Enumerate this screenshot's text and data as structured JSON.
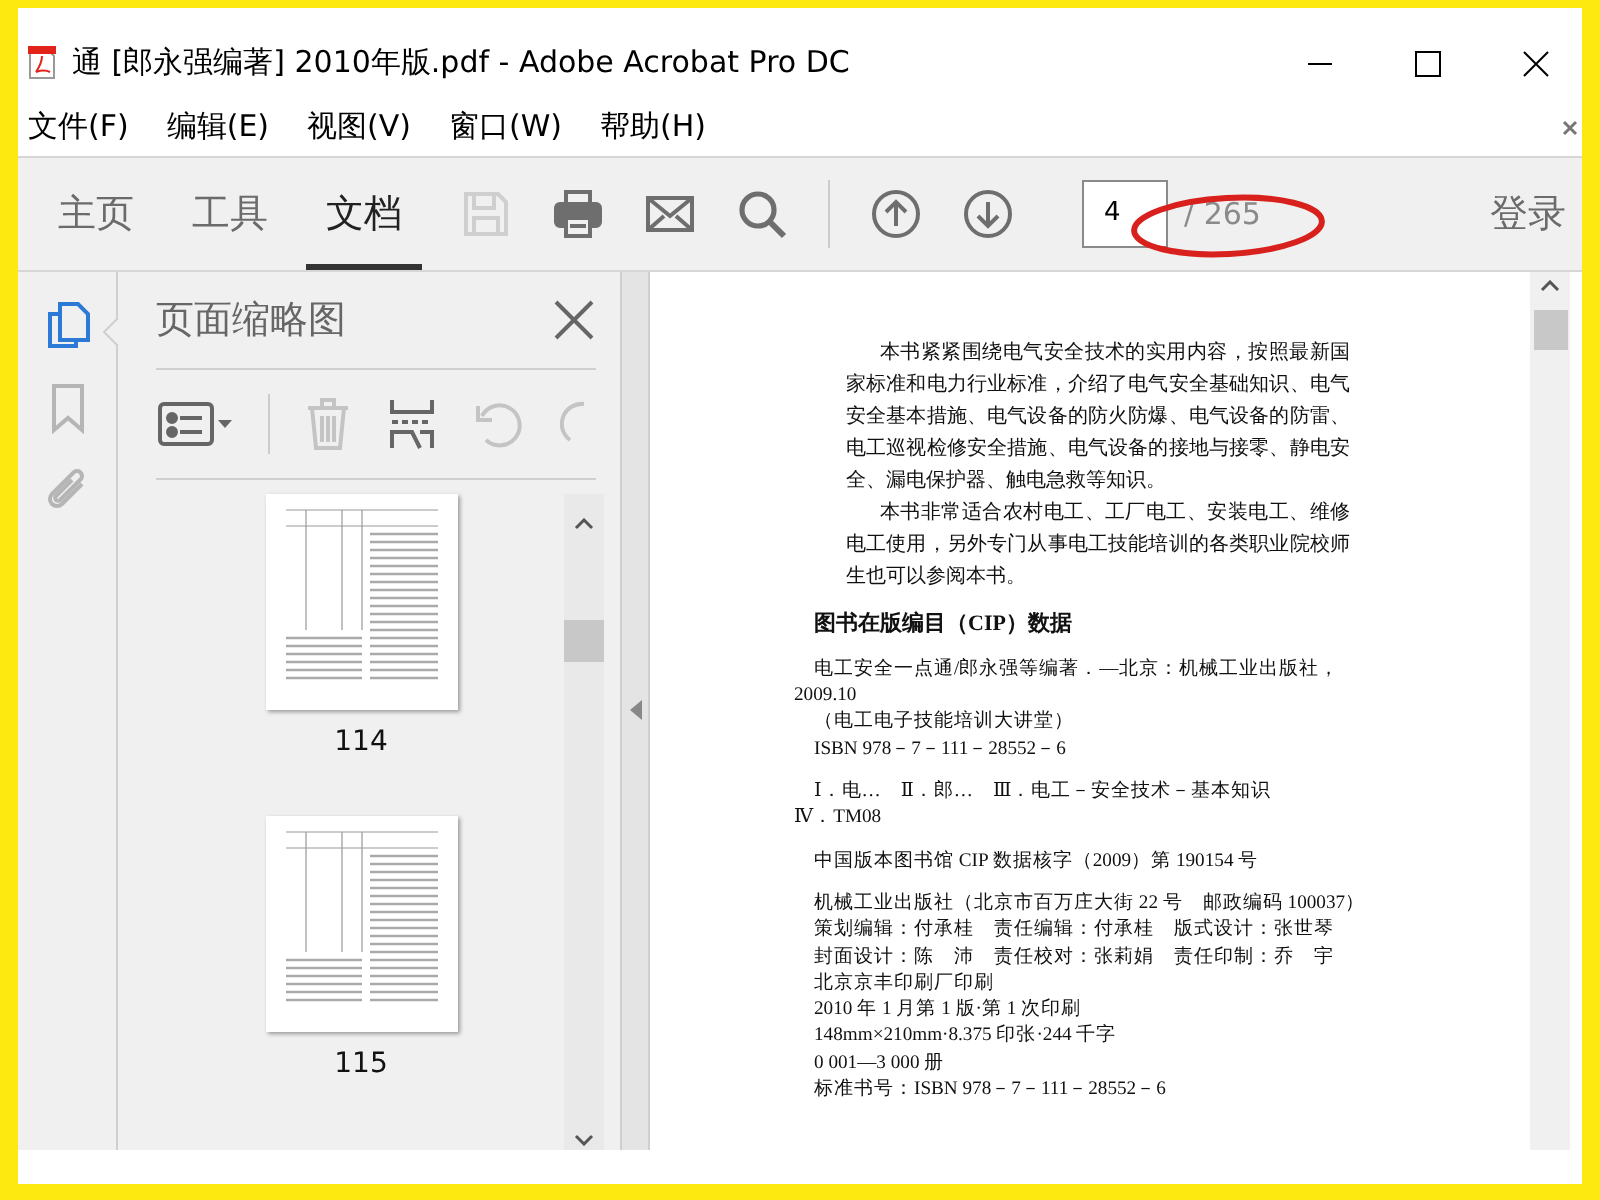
{
  "window": {
    "title": "通 [郎永强编著] 2010年版.pdf - Adobe Acrobat Pro DC"
  },
  "menu": [
    {
      "label": "文件(F)"
    },
    {
      "label": "编辑(E)"
    },
    {
      "label": "视图(V)"
    },
    {
      "label": "窗口(W)"
    },
    {
      "label": "帮助(H)"
    }
  ],
  "tabs": [
    {
      "label": "主页",
      "selected": false
    },
    {
      "label": "工具",
      "selected": false
    },
    {
      "label": "文档",
      "selected": true
    }
  ],
  "toolbar": {
    "tools": [
      {
        "kind": "save",
        "disabled": true
      },
      {
        "kind": "print",
        "disabled": false
      },
      {
        "kind": "mail",
        "disabled": false
      },
      {
        "kind": "search",
        "disabled": false
      },
      {
        "kind": "separator"
      },
      {
        "kind": "up",
        "disabled": false
      },
      {
        "kind": "down",
        "disabled": false
      }
    ],
    "page_current": "4",
    "page_total": "/ 265",
    "sign_in": "登录"
  },
  "side_icons": [
    {
      "kind": "pages",
      "selected": true
    },
    {
      "kind": "bookmark",
      "selected": false
    },
    {
      "kind": "attachment",
      "selected": false
    }
  ],
  "panel": {
    "title": "页面缩略图",
    "tools": [
      {
        "kind": "options",
        "disabled": false
      },
      {
        "kind": "separator"
      },
      {
        "kind": "delete",
        "disabled": true
      },
      {
        "kind": "insert",
        "disabled": false
      },
      {
        "kind": "undo",
        "disabled": true
      },
      {
        "kind": "redo",
        "disabled": true
      }
    ],
    "thumbnails": [
      {
        "label": "114"
      },
      {
        "label": "115"
      }
    ]
  },
  "document": {
    "blocks": [
      {
        "kind": "para",
        "lines": [
          {
            "text": "本书紧紧围绕电气安全技术的实用内容，按照最新国家标准和电力行业标准，介绍了电气安全基础知识、电气安全基本措施、电气设备的防火防爆、电气设备的防雷、电工巡视检修安全措施、电气设备的接地与接零、静电安全、漏电保护器、触电急救等知识。"
          },
          {
            "text": "本书非常适合农村电工、工厂电工、安装电工、维修电工使用，另外专门从事电工技能培训的各类职业院校师生也可以参阅本书。"
          }
        ]
      },
      {
        "kind": "heading",
        "lines": [
          {
            "text": "图书在版编目（CIP）数据"
          }
        ]
      },
      {
        "kind": "lines",
        "lines": [
          {
            "text": "电工安全一点通/郎永强等编著．—北京：机械工业出版社，",
            "indent": true
          },
          {
            "text": "2009.10",
            "indent": false
          },
          {
            "text": "（电工电子技能培训大讲堂）",
            "indent": true
          },
          {
            "text": "ISBN 978－7－111－28552－6",
            "indent": true
          }
        ]
      },
      {
        "kind": "lines",
        "lines": [
          {
            "text": "Ⅰ．电…　Ⅱ．郎…　Ⅲ．电工－安全技术－基本知识",
            "indent": true
          },
          {
            "text": "Ⅳ．TM08",
            "indent": false
          }
        ]
      },
      {
        "kind": "lines",
        "lines": [
          {
            "text": "中国版本图书馆 CIP 数据核字（2009）第 190154 号",
            "indent": true
          }
        ]
      },
      {
        "kind": "lines",
        "lines": [
          {
            "text": "机械工业出版社（北京市百万庄大街 22 号　邮政编码 100037）",
            "indent": true
          },
          {
            "text": "策划编辑：付承桂　责任编辑：付承桂　版式设计：张世琴",
            "indent": true
          },
          {
            "text": "封面设计：陈　沛　责任校对：张莉娟　责任印制：乔　宇",
            "indent": true
          },
          {
            "text": "北京京丰印刷厂印刷",
            "indent": true
          },
          {
            "text": "2010 年 1 月第 1 版·第 1 次印刷",
            "indent": true
          },
          {
            "text": "148mm×210mm·8.375 印张·244 千字",
            "indent": true
          },
          {
            "text": "0 001—3 000 册",
            "indent": true
          },
          {
            "text": "标准书号：ISBN 978－7－111－28552－6",
            "indent": true
          }
        ]
      }
    ]
  }
}
